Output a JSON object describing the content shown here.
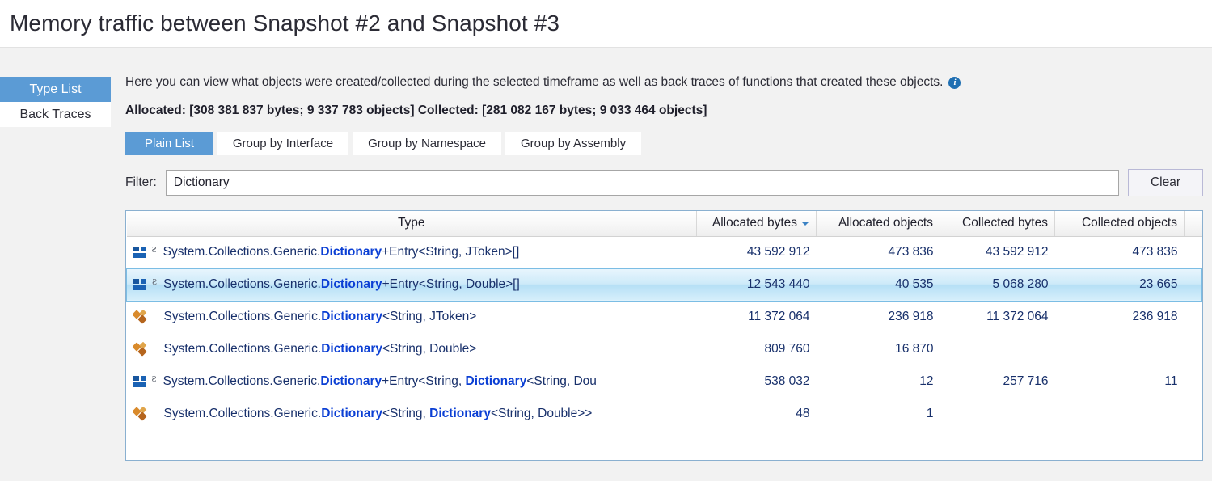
{
  "window": {
    "title": "Memory traffic between Snapshot #2 and Snapshot #3"
  },
  "sidebar": {
    "items": [
      {
        "label": "Type List",
        "active": true
      },
      {
        "label": "Back Traces",
        "active": false
      }
    ]
  },
  "main": {
    "info_text": "Here you can view what objects were created/collected during the selected timeframe as well as back traces of functions that created these objects.",
    "info_icon": "info-icon",
    "summary": "Allocated: [308 381 837 bytes; 9 337 783 objects] Collected: [281 082 167 bytes; 9 033 464 objects]",
    "tabs": [
      {
        "label": "Plain List",
        "active": true
      },
      {
        "label": "Group by Interface",
        "active": false
      },
      {
        "label": "Group by Namespace",
        "active": false
      },
      {
        "label": "Group by Assembly",
        "active": false
      }
    ],
    "filter": {
      "label": "Filter:",
      "value": "Dictionary",
      "placeholder": "",
      "clear_label": "Clear"
    },
    "table": {
      "columns": [
        {
          "label": "Type",
          "sorted": false
        },
        {
          "label": "Allocated bytes",
          "sorted": true,
          "sort_dir": "desc"
        },
        {
          "label": "Allocated objects",
          "sorted": false
        },
        {
          "label": "Collected bytes",
          "sorted": false
        },
        {
          "label": "Collected objects",
          "sorted": false
        }
      ],
      "rows": [
        {
          "icon": "struct-icon",
          "marker": "Ƨ",
          "type_parts": [
            {
              "t": "System.Collections.Generic.",
              "kw": false
            },
            {
              "t": "Dictionary",
              "kw": true
            },
            {
              "t": "+Entry<String, JToken>[]",
              "kw": false
            }
          ],
          "allocated_bytes": "43 592 912",
          "allocated_objects": "473 836",
          "collected_bytes": "43 592 912",
          "collected_objects": "473 836",
          "selected": false
        },
        {
          "icon": "struct-icon",
          "marker": "Ƨ",
          "type_parts": [
            {
              "t": "System.Collections.Generic.",
              "kw": false
            },
            {
              "t": "Dictionary",
              "kw": true
            },
            {
              "t": "+Entry<String, Double>[]",
              "kw": false
            }
          ],
          "allocated_bytes": "12 543 440",
          "allocated_objects": "40 535",
          "collected_bytes": "5 068 280",
          "collected_objects": "23 665",
          "selected": true
        },
        {
          "icon": "class-icon",
          "marker": "",
          "type_parts": [
            {
              "t": "System.Collections.Generic.",
              "kw": false
            },
            {
              "t": "Dictionary",
              "kw": true
            },
            {
              "t": "<String, JToken>",
              "kw": false
            }
          ],
          "allocated_bytes": "11 372 064",
          "allocated_objects": "236 918",
          "collected_bytes": "11 372 064",
          "collected_objects": "236 918",
          "selected": false
        },
        {
          "icon": "class-icon",
          "marker": "",
          "type_parts": [
            {
              "t": "System.Collections.Generic.",
              "kw": false
            },
            {
              "t": "Dictionary",
              "kw": true
            },
            {
              "t": "<String, Double>",
              "kw": false
            }
          ],
          "allocated_bytes": "809 760",
          "allocated_objects": "16 870",
          "collected_bytes": "",
          "collected_objects": "",
          "selected": false
        },
        {
          "icon": "struct-icon",
          "marker": "Ƨ",
          "type_parts": [
            {
              "t": "System.Collections.Generic.",
              "kw": false
            },
            {
              "t": "Dictionary",
              "kw": true
            },
            {
              "t": "+Entry<String, ",
              "kw": false
            },
            {
              "t": "Dictionary",
              "kw": true
            },
            {
              "t": "<String, Dou",
              "kw": false
            }
          ],
          "allocated_bytes": "538 032",
          "allocated_objects": "12",
          "collected_bytes": "257 716",
          "collected_objects": "11",
          "selected": false
        },
        {
          "icon": "class-icon",
          "marker": "",
          "type_parts": [
            {
              "t": "System.Collections.Generic.",
              "kw": false
            },
            {
              "t": "Dictionary",
              "kw": true
            },
            {
              "t": "<String, ",
              "kw": false
            },
            {
              "t": "Dictionary",
              "kw": true
            },
            {
              "t": "<String, Double>>",
              "kw": false
            }
          ],
          "allocated_bytes": "48",
          "allocated_objects": "1",
          "collected_bytes": "",
          "collected_objects": "",
          "selected": false
        }
      ]
    }
  },
  "colors": {
    "accent": "#5b9bd5",
    "keyword": "#0b3fd4",
    "number_text": "#18306b",
    "selection": "#b6e0f6",
    "struct_icon": "#1a62b4",
    "class_icon": "#b5651d"
  }
}
